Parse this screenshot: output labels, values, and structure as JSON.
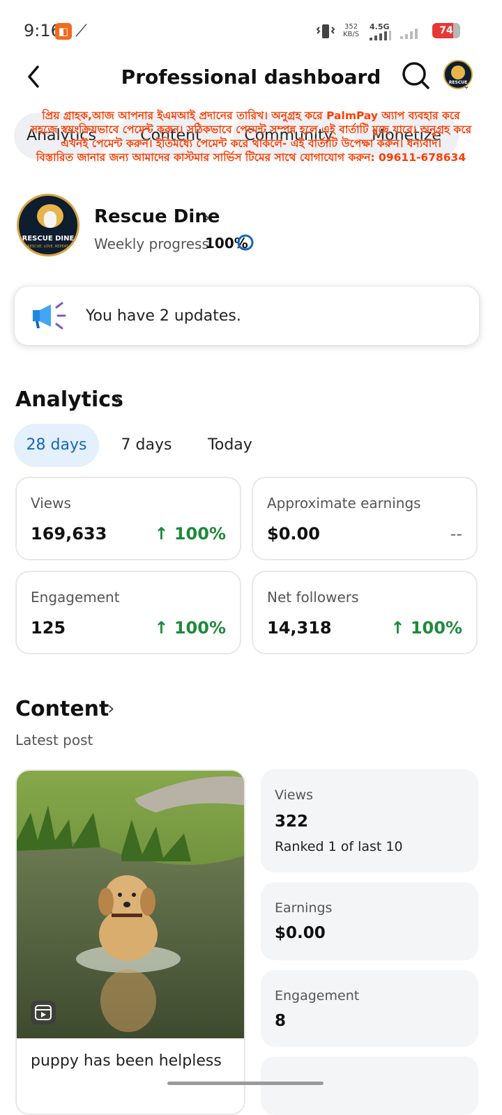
{
  "status_bar": {
    "time": "9:16",
    "net_speed_value": "352",
    "net_speed_unit": "KB/S",
    "network": "4.5G",
    "battery": "74",
    "battery_level": 0.74
  },
  "header": {
    "title": "Professional dashboard"
  },
  "tabs": [
    "Analytics",
    "Content",
    "Community",
    "Monetize"
  ],
  "notice": {
    "line1": "প্রিয় গ্রাহক,আজ আপনার ইএমআই প্রদানের তারিখ। অনুগ্রহ করে PalmPay অ্যাপ ব্যবহার করে সহজে স্বয়ংক্রিয়ভাবে পেমেন্ট করুন। সঠিকভাবে পেমেন্ট সম্পন্ন হলে এই বার্তাটি মুছে যাবে। অনুগ্রহ করে এখনই পেমেন্ট করুন। ইতিমধ্যে পেমেন্ট করে থাকলে- এই বার্তাটি উপেক্ষা করুন। ধন্যবাদ।",
    "line2": "বিস্তারিত জানার জন্য আমাদের কাস্টমার সার্ভিস টিমের সাথে যোগাযোগ করুন: 09611-678634"
  },
  "profile": {
    "name": "Rescue Dine",
    "avatar_text": "RESCUE DINE",
    "avatar_tagline": "RESCUE. LOVE. REPEAT.",
    "progress_label": "Weekly progress",
    "progress_value": "100%"
  },
  "updates": {
    "text": "You have 2 updates."
  },
  "analytics": {
    "title": "Analytics",
    "ranges": [
      "28 days",
      "7 days",
      "Today"
    ],
    "active_range": "28 days",
    "metrics": [
      {
        "label": "Views",
        "value": "169,633",
        "delta": "↑ 100%"
      },
      {
        "label": "Approximate earnings",
        "value": "$0.00",
        "delta": "--"
      },
      {
        "label": "Engagement",
        "value": "125",
        "delta": "↑ 100%"
      },
      {
        "label": "Net followers",
        "value": "14,318",
        "delta": "↑ 100%"
      }
    ]
  },
  "content": {
    "title": "Content",
    "latest_label": "Latest post",
    "post_caption": "puppy has been helpless",
    "stats": {
      "views_label": "Views",
      "views_value": "322",
      "views_rank": "Ranked 1 of last 10",
      "earnings_label": "Earnings",
      "earnings_value": "$0.00",
      "engagement_label": "Engagement",
      "engagement_value": "8"
    }
  },
  "colors": {
    "accent_blue": "#1565c0",
    "pill_active_bg": "#e4f0fc",
    "positive_green": "#1e8a3a",
    "notice_red": "#ff3b00",
    "battery_red": "#e53935"
  },
  "icons": [
    "back-icon",
    "search-icon",
    "megaphone-icon",
    "chevron-right-icon",
    "progress-ring-icon",
    "reel-icon"
  ]
}
